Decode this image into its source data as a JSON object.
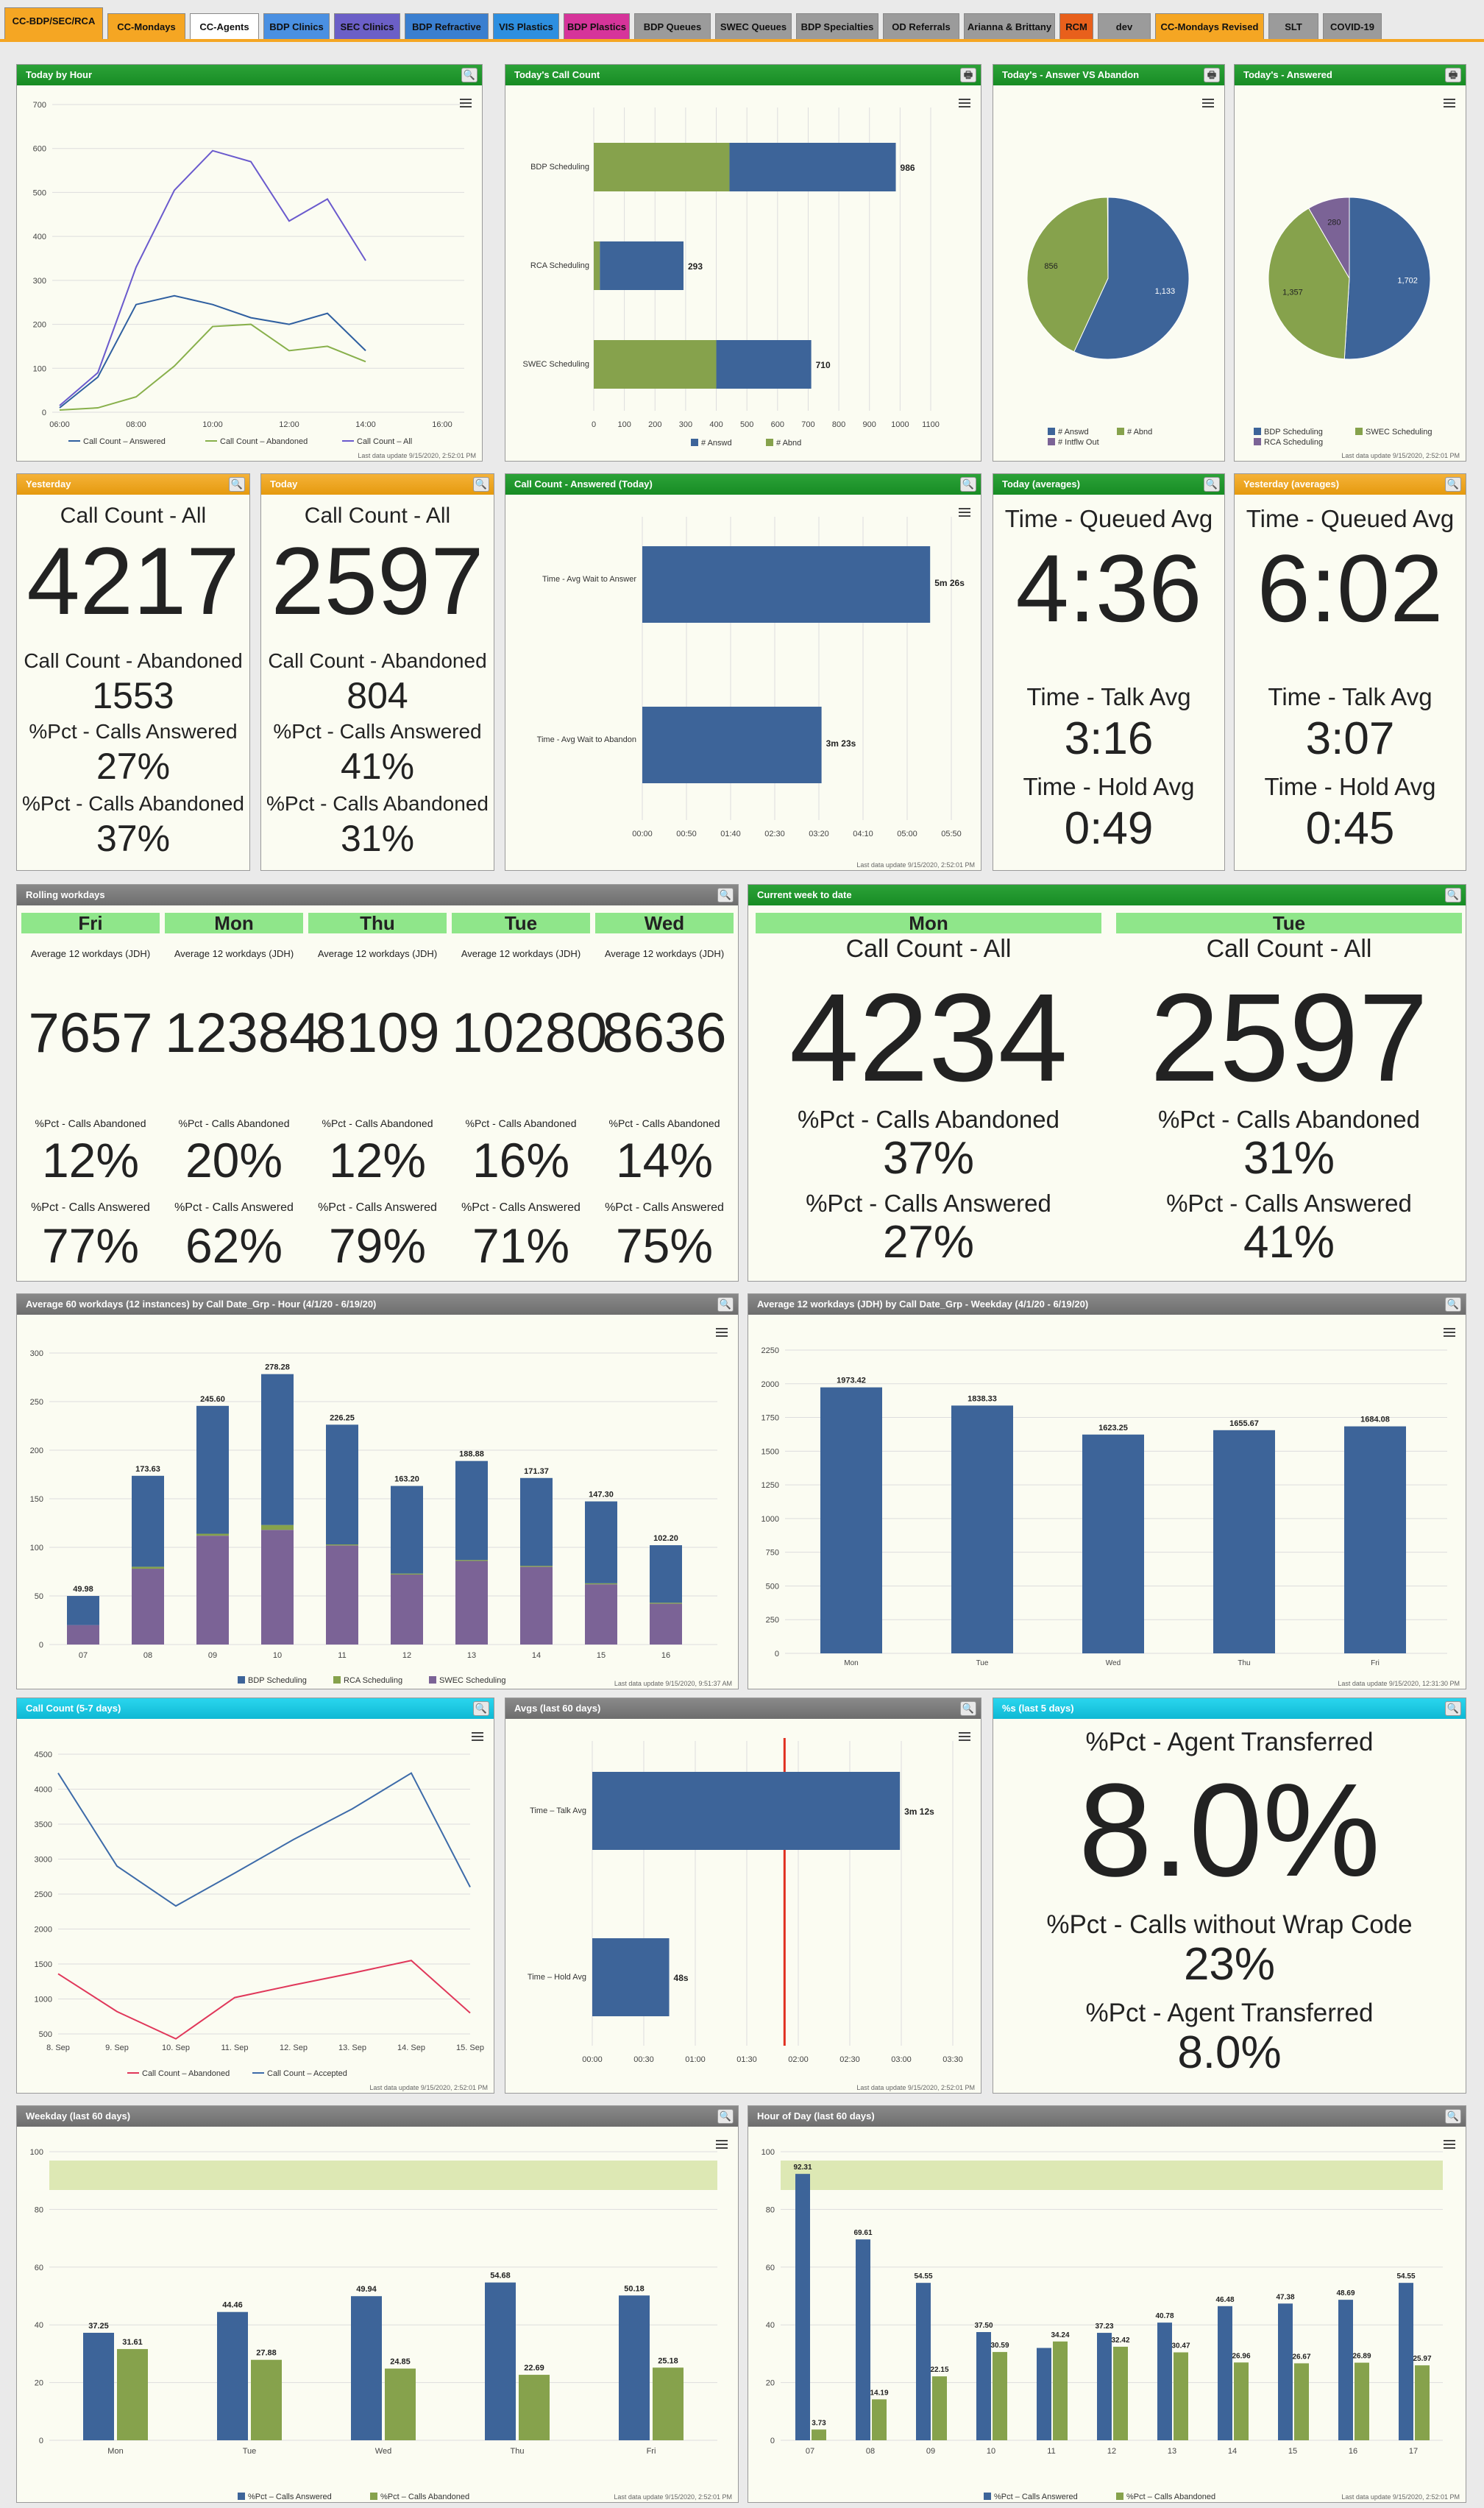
{
  "tabs": [
    {
      "label": "CC-BDP/SEC/RCA",
      "color": "#f5a623"
    },
    {
      "label": "CC-Mondays",
      "color": "#f5a623"
    },
    {
      "label": "CC-Agents",
      "color": "#ffffff"
    },
    {
      "label": "BDP Clinics",
      "color": "#4a90e2"
    },
    {
      "label": "SEC Clinics",
      "color": "#6b5fc7"
    },
    {
      "label": "BDP Refractive",
      "color": "#3a7fd0"
    },
    {
      "label": "VIS Plastics",
      "color": "#2d8fe0"
    },
    {
      "label": "BDP Plastics",
      "color": "#d6349a"
    },
    {
      "label": "BDP Queues",
      "color": "#9b9b9b"
    },
    {
      "label": "SWEC Queues",
      "color": "#9b9b9b"
    },
    {
      "label": "BDP Specialties",
      "color": "#9b9b9b"
    },
    {
      "label": "OD Referrals",
      "color": "#9b9b9b"
    },
    {
      "label": "Arianna & Brittany",
      "color": "#9b9b9b"
    },
    {
      "label": "RCM",
      "color": "#e8601c"
    },
    {
      "label": "dev",
      "color": "#9b9b9b"
    },
    {
      "label": "CC-Mondays Revised",
      "color": "#f5a623"
    },
    {
      "label": "SLT",
      "color": "#9b9b9b"
    },
    {
      "label": "COVID-19",
      "color": "#9b9b9b"
    }
  ],
  "panels": {
    "today_by_hour": {
      "title": "Today by Hour",
      "footer": "Last data update 9/15/2020, 2:52:01 PM",
      "legend": [
        "Call Count – Answered",
        "Call Count – Abandoned",
        "Call Count – All"
      ]
    },
    "todays_call_count": {
      "title": "Today's Call Count",
      "legend": [
        "# Answd",
        "# Abnd"
      ]
    },
    "answer_vs_abandon": {
      "title": "Today's - Answer VS Abandon",
      "legend": [
        "# Answd",
        "# Abnd",
        "# Intflw Out"
      ]
    },
    "todays_answered": {
      "title": "Today's - Answered",
      "footer": "Last data update 9/15/2020, 2:52:01 PM",
      "legend": [
        "BDP Scheduling",
        "SWEC Scheduling",
        "RCA Scheduling"
      ]
    },
    "yesterday": {
      "title": "Yesterday",
      "l1": "Call Count - All",
      "v1": "4217",
      "l2": "Call Count - Abandoned",
      "v2": "1553",
      "l3": "%Pct - Calls Answered",
      "v3": "27%",
      "l4": "%Pct - Calls Abandoned",
      "v4": "37%"
    },
    "today": {
      "title": "Today",
      "l1": "Call Count - All",
      "v1": "2597",
      "l2": "Call Count - Abandoned",
      "v2": "804",
      "l3": "%Pct - Calls Answered",
      "v3": "41%",
      "l4": "%Pct - Calls Abandoned",
      "v4": "31%"
    },
    "call_count_answered": {
      "title": "Call Count - Answered (Today)",
      "footer": "Last data update 9/15/2020, 2:52:01 PM"
    },
    "today_avg": {
      "title": "Today (averages)",
      "l1": "Time - Queued Avg",
      "v1": "4:36",
      "l2": "Time - Talk Avg",
      "v2": "3:16",
      "l3": "Time - Hold Avg",
      "v3": "0:49"
    },
    "yesterday_avg": {
      "title": "Yesterday (averages)",
      "l1": "Time - Queued Avg",
      "v1": "6:02",
      "l2": "Time - Talk Avg",
      "v2": "3:07",
      "l3": "Time - Hold Avg",
      "v3": "0:45"
    },
    "rolling": {
      "title": "Rolling workdays",
      "cols": [
        {
          "day": "Fri",
          "avg": "Average 12 workdays (JDH)",
          "count": "7657",
          "l_ab": "%Pct - Calls Abandoned",
          "ab": "12%",
          "l_an": "%Pct - Calls Answered",
          "an": "77%"
        },
        {
          "day": "Mon",
          "avg": "Average 12 workdays (JDH)",
          "count": "12384",
          "l_ab": "%Pct - Calls Abandoned",
          "ab": "20%",
          "l_an": "%Pct - Calls Answered",
          "an": "62%"
        },
        {
          "day": "Thu",
          "avg": "Average 12 workdays (JDH)",
          "count": "8109",
          "l_ab": "%Pct - Calls Abandoned",
          "ab": "12%",
          "l_an": "%Pct - Calls Answered",
          "an": "79%"
        },
        {
          "day": "Tue",
          "avg": "Average 12 workdays (JDH)",
          "count": "10280",
          "l_ab": "%Pct - Calls Abandoned",
          "ab": "16%",
          "l_an": "%Pct - Calls Answered",
          "an": "71%"
        },
        {
          "day": "Wed",
          "avg": "Average 12 workdays (JDH)",
          "count": "8636",
          "l_ab": "%Pct - Calls Abandoned",
          "ab": "14%",
          "l_an": "%Pct - Calls Answered",
          "an": "75%"
        }
      ]
    },
    "current_week": {
      "title": "Current week to date",
      "cols": [
        {
          "day": "Mon",
          "l1": "Call Count - All",
          "count": "4234",
          "l2": "%Pct - Calls Abandoned",
          "ab": "37%",
          "l3": "%Pct - Calls Answered",
          "an": "27%"
        },
        {
          "day": "Tue",
          "l1": "Call Count - All",
          "count": "2597",
          "l2": "%Pct - Calls Abandoned",
          "ab": "31%",
          "l3": "%Pct - Calls Answered",
          "an": "41%"
        }
      ]
    },
    "avg60_hour": {
      "title": "Average 60 workdays (12 instances) by Call Date_Grp - Hour (4/1/20 - 6/19/20)",
      "footer": "Last data update 9/15/2020, 9:51:37 AM",
      "legend": [
        "BDP Scheduling",
        "RCA Scheduling",
        "SWEC Scheduling"
      ]
    },
    "avg12_weekday": {
      "title": "Average 12 workdays (JDH) by Call Date_Grp - Weekday (4/1/20 - 6/19/20)",
      "footer": "Last data update 9/15/2020, 12:31:30 PM"
    },
    "call_count_57": {
      "title": "Call Count (5-7 days)",
      "footer": "Last data update 9/15/2020, 2:52:01 PM",
      "legend": [
        "Call Count – Abandoned",
        "Call Count – Accepted"
      ]
    },
    "avgs60": {
      "title": "Avgs (last 60 days)",
      "footer": "Last data update 9/15/2020, 2:52:01 PM"
    },
    "pct5": {
      "title": "%s (last 5 days)",
      "l1": "%Pct - Agent Transferred",
      "v1": "8.0%",
      "l2": "%Pct - Calls without Wrap Code",
      "v2": "23%",
      "l3": "%Pct - Agent Transferred",
      "v3": "8.0%"
    },
    "weekday60": {
      "title": "Weekday (last 60 days)",
      "footer": "Last data update 9/15/2020, 2:52:01 PM",
      "legend": [
        "%Pct – Calls Answered",
        "%Pct – Calls Abandoned"
      ]
    },
    "hour60": {
      "title": "Hour of Day (last 60 days)",
      "footer": "Last data update 9/15/2020, 2:52:01 PM",
      "legend": [
        "%Pct – Calls Answered",
        "%Pct – Calls Abandoned"
      ]
    }
  },
  "chart_data": [
    {
      "type": "line",
      "title": "Today by Hour",
      "x": [
        "06:00",
        "07:00",
        "08:00",
        "09:00",
        "10:00",
        "11:00",
        "12:00",
        "13:00",
        "14:00"
      ],
      "series": [
        {
          "name": "Call Count – Answered",
          "values": [
            10,
            80,
            245,
            265,
            245,
            215,
            200,
            225,
            140
          ]
        },
        {
          "name": "Call Count – Abandoned",
          "values": [
            5,
            10,
            35,
            105,
            195,
            200,
            140,
            150,
            115
          ]
        },
        {
          "name": "Call Count – All",
          "values": [
            15,
            90,
            330,
            505,
            595,
            570,
            435,
            485,
            345
          ]
        }
      ],
      "xlabels": [
        "06:00",
        "08:00",
        "10:00",
        "12:00",
        "14:00",
        "16:00"
      ],
      "ylim": [
        0,
        700
      ],
      "yticks": [
        0,
        100,
        200,
        300,
        400,
        500,
        600,
        700
      ]
    },
    {
      "type": "bar",
      "title": "Today's Call Count",
      "categories": [
        "BDP Scheduling",
        "RCA Scheduling",
        "SWEC Scheduling"
      ],
      "series": [
        {
          "name": "# Abnd",
          "values": [
            443,
            20,
            400
          ]
        },
        {
          "name": "# Answd",
          "values": [
            543,
            273,
            310
          ]
        }
      ],
      "totals": [
        986,
        293,
        710
      ],
      "xlim": [
        0,
        1100
      ],
      "xticks": [
        0,
        100,
        200,
        300,
        400,
        500,
        600,
        700,
        800,
        900,
        1000,
        1100
      ]
    },
    {
      "type": "pie",
      "title": "Today's - Answer VS Abandon",
      "slices": [
        {
          "name": "# Answd",
          "value": 1133
        },
        {
          "name": "# Abnd",
          "value": 856
        },
        {
          "name": "# Intflw Out",
          "value": 2
        }
      ]
    },
    {
      "type": "pie",
      "title": "Today's - Answered",
      "slices": [
        {
          "name": "BDP Scheduling",
          "value": 1702
        },
        {
          "name": "SWEC Scheduling",
          "value": 1357
        },
        {
          "name": "RCA Scheduling",
          "value": 280
        }
      ]
    },
    {
      "type": "bar",
      "title": "Call Count - Answered (Today)",
      "categories": [
        "Time - Avg Wait to Answer",
        "Time - Avg Wait to Abandon"
      ],
      "values": [
        326,
        203
      ],
      "labels": [
        "5m 26s",
        "3m 23s"
      ],
      "xticks": [
        "00:00",
        "00:50",
        "01:40",
        "02:30",
        "03:20",
        "04:10",
        "05:00",
        "05:50"
      ],
      "xlim": [
        0,
        350
      ]
    },
    {
      "type": "bar",
      "title": "Average 60 workdays (12 instances) by Call Date_Grp - Hour (4/1/20 - 6/19/20)",
      "categories": [
        "07",
        "08",
        "09",
        "10",
        "11",
        "12",
        "13",
        "14",
        "15",
        "16"
      ],
      "series": [
        {
          "name": "SWEC Scheduling",
          "values": [
            20,
            78,
            112,
            118,
            102,
            72,
            86,
            80,
            62,
            42
          ]
        },
        {
          "name": "RCA Scheduling",
          "values": [
            0,
            2,
            2,
            5,
            1,
            1,
            1,
            1,
            1,
            1
          ]
        },
        {
          "name": "BDP Scheduling",
          "values": [
            29.98,
            93.63,
            131.6,
            155.28,
            123.25,
            90.2,
            101.88,
            90.37,
            84.3,
            59.2
          ]
        }
      ],
      "totals": [
        "49.98",
        "173.63",
        "245.60",
        "278.28",
        "226.25",
        "163.20",
        "188.88",
        "171.37",
        "147.30",
        "102.20"
      ],
      "ylim": [
        0,
        300
      ],
      "yticks": [
        0,
        50,
        100,
        150,
        200,
        250,
        300
      ]
    },
    {
      "type": "bar",
      "title": "Average 12 workdays (JDH) by Call Date_Grp - Weekday (4/1/20 - 6/19/20)",
      "categories": [
        "Mon",
        "Tue",
        "Wed",
        "Thu",
        "Fri"
      ],
      "values": [
        1973.42,
        1838.33,
        1623.25,
        1655.67,
        1684.08
      ],
      "ylim": [
        0,
        2250
      ],
      "yticks": [
        0,
        250,
        500,
        750,
        1000,
        1250,
        1500,
        1750,
        2000,
        2250
      ]
    },
    {
      "type": "line",
      "title": "Call Count (5-7 days)",
      "x": [
        "8. Sep",
        "9. Sep",
        "10. Sep",
        "11. Sep",
        "12. Sep",
        "13. Sep",
        "14. Sep",
        "15. Sep"
      ],
      "series": [
        {
          "name": "Call Count – Abandoned",
          "values": [
            1360,
            820,
            430,
            1020,
            1200,
            1370,
            1550,
            800
          ]
        },
        {
          "name": "Call Count – Accepted",
          "values": [
            4230,
            2900,
            2330,
            2800,
            3280,
            3720,
            4230,
            2600
          ]
        }
      ],
      "ylim": [
        500,
        4500
      ],
      "yticks": [
        500,
        1000,
        1500,
        2000,
        2500,
        3000,
        3500,
        4000,
        4500
      ]
    },
    {
      "type": "bar",
      "title": "Avgs (last 60 days)",
      "categories": [
        "Time – Talk Avg",
        "Time – Hold Avg"
      ],
      "values": [
        192,
        48
      ],
      "labels": [
        "3m 12s",
        "48s"
      ],
      "xticks": [
        "00:00",
        "00:30",
        "01:00",
        "01:30",
        "02:00",
        "02:30",
        "03:00",
        "03:30"
      ],
      "xlim": [
        0,
        225
      ],
      "plotline": 120
    },
    {
      "type": "bar",
      "title": "Weekday (last 60 days)",
      "categories": [
        "Mon",
        "Tue",
        "Wed",
        "Thu",
        "Fri"
      ],
      "series": [
        {
          "name": "%Pct – Calls Answered",
          "values": [
            37.25,
            44.46,
            49.94,
            54.68,
            50.18
          ]
        },
        {
          "name": "%Pct – Calls Abandoned",
          "values": [
            31.61,
            27.88,
            24.85,
            22.69,
            25.18
          ]
        }
      ],
      "ylim": [
        0,
        100
      ],
      "yticks": [
        0,
        20,
        40,
        60,
        80,
        100
      ]
    },
    {
      "type": "bar",
      "title": "Hour of Day (last 60 days)",
      "categories": [
        "07",
        "08",
        "09",
        "10",
        "11",
        "12",
        "13",
        "14",
        "15",
        "16",
        "17"
      ],
      "series": [
        {
          "name": "%Pct – Calls Answered",
          "values": [
            92.31,
            69.61,
            54.55,
            37.5,
            32,
            37.23,
            40.78,
            46.48,
            47.38,
            48.69,
            54.55
          ]
        },
        {
          "name": "%Pct – Calls Abandoned",
          "values": [
            3.73,
            14.19,
            22.15,
            30.59,
            34.24,
            32.42,
            30.47,
            26.96,
            26.67,
            26.89,
            25.97
          ]
        }
      ],
      "labels_answered": [
        "92.31",
        "69.61",
        "54.55",
        "37.50",
        "",
        "37.23",
        "40.78",
        "46.48",
        "47.38",
        "48.69",
        "54.55"
      ],
      "labels_abandoned": [
        "3.73",
        "14.19",
        "22.15",
        "30.59",
        "34.24",
        "32.42",
        "30.47",
        "26.96",
        "26.67",
        "26.89",
        "25.97"
      ],
      "ylim": [
        0,
        100
      ],
      "yticks": [
        0,
        20,
        40,
        60,
        80,
        100
      ]
    }
  ],
  "colors": {
    "blue": "#3d6499",
    "green": "#86a24c",
    "purple": "#7b6396",
    "red": "#e0375a",
    "lineblue": "#3d6ba9",
    "band": "#dde8b4",
    "plotline": "#e03020"
  }
}
